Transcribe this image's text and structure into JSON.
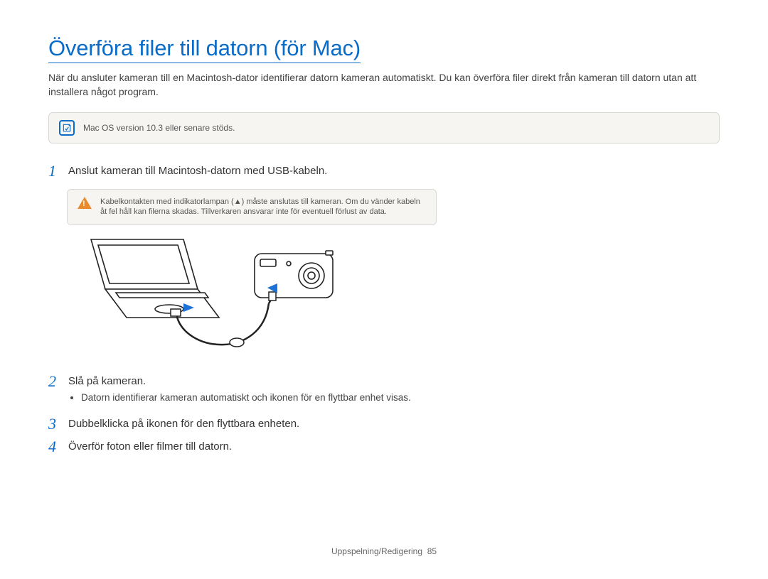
{
  "title": "Överföra filer till datorn (för Mac)",
  "intro": "När du ansluter kameran till en Macintosh-dator identifierar datorn kameran automatiskt. Du kan överföra filer direkt från kameran till datorn utan att installera något program.",
  "note": {
    "icon_label": "note",
    "text": "Mac OS version 10.3 eller senare stöds."
  },
  "steps": [
    {
      "num": "1",
      "text": "Anslut kameran till Macintosh-datorn med USB-kabeln."
    },
    {
      "num": "2",
      "text": "Slå på kameran.",
      "bullets": [
        "Datorn identifierar kameran automatiskt och ikonen för en flyttbar enhet visas."
      ]
    },
    {
      "num": "3",
      "text": "Dubbelklicka på ikonen för den flyttbara enheten."
    },
    {
      "num": "4",
      "text": "Överför foton eller filmer till datorn."
    }
  ],
  "warning": {
    "text": "Kabelkontakten med indikatorlampan (▲) måste anslutas till kameran. Om du vänder kabeln åt fel håll kan filerna skadas. Tillverkaren ansvarar inte för eventuell förlust av data."
  },
  "footer": {
    "section": "Uppspelning/Redigering",
    "page": "85"
  }
}
